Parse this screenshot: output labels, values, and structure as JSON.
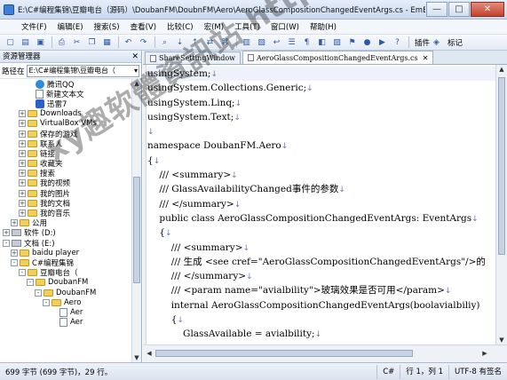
{
  "window": {
    "title": "E:\\C#编程集锦\\豆瓣电台（源码）\\DoubanFM\\DoubnFM\\Aero\\AeroGlassCompositionChangedEventArgs.cs - EmEditor",
    "minimize": "—",
    "maximize": "□",
    "close": "✕"
  },
  "menu": [
    "文件(F)",
    "编辑(E)",
    "搜索(S)",
    "查看(V)",
    "比较(C)",
    "宏(M)",
    "工具(T)",
    "窗口(W)",
    "帮助(H)"
  ],
  "toolbar": {
    "plugin_label": "插件",
    "mark_label": "标记"
  },
  "left_panel": {
    "title": "资源管理器",
    "close": "✕",
    "path_label": "路径在",
    "path_value": "E:\\C#编程集锦\\豆瓣电台（",
    "tree": [
      {
        "label": "腾讯QQ",
        "icon": "qq-icon",
        "indent": 4,
        "toggle": ""
      },
      {
        "label": "新建文本文",
        "icon": "file-icon",
        "indent": 4,
        "toggle": ""
      },
      {
        "label": "迅雷7",
        "icon": "thunder-icon",
        "indent": 4,
        "toggle": ""
      },
      {
        "label": "Downloads",
        "icon": "folder-icon",
        "indent": 3,
        "toggle": "+"
      },
      {
        "label": "VirtualBox VMs",
        "icon": "folder-icon",
        "indent": 3,
        "toggle": "+"
      },
      {
        "label": "保存的游戏",
        "icon": "folder-icon",
        "indent": 3,
        "toggle": "+"
      },
      {
        "label": "联系人",
        "icon": "folder-icon",
        "indent": 3,
        "toggle": "+"
      },
      {
        "label": "链接",
        "icon": "folder-icon",
        "indent": 3,
        "toggle": "+"
      },
      {
        "label": "收藏夹",
        "icon": "folder-icon",
        "indent": 3,
        "toggle": "+"
      },
      {
        "label": "搜索",
        "icon": "folder-icon",
        "indent": 3,
        "toggle": "+"
      },
      {
        "label": "我的视频",
        "icon": "folder-icon",
        "indent": 3,
        "toggle": "+"
      },
      {
        "label": "我的图片",
        "icon": "folder-icon",
        "indent": 3,
        "toggle": "+"
      },
      {
        "label": "我的文档",
        "icon": "folder-icon",
        "indent": 3,
        "toggle": "+"
      },
      {
        "label": "我的音乐",
        "icon": "folder-icon",
        "indent": 3,
        "toggle": "+"
      },
      {
        "label": "公用",
        "icon": "folder-icon",
        "indent": 2,
        "toggle": "+"
      },
      {
        "label": "软件 (D:)",
        "icon": "drive-icon",
        "indent": 1,
        "toggle": "+"
      },
      {
        "label": "文档 (E:)",
        "icon": "drive-icon",
        "indent": 1,
        "toggle": "-"
      },
      {
        "label": "baidu player",
        "icon": "folder-icon",
        "indent": 2,
        "toggle": "+"
      },
      {
        "label": "C#编程集锦",
        "icon": "folder-icon",
        "indent": 2,
        "toggle": "-"
      },
      {
        "label": "豆瓣电台（",
        "icon": "folder-icon",
        "indent": 3,
        "toggle": "-"
      },
      {
        "label": "DoubanFM",
        "icon": "folder-icon",
        "indent": 4,
        "toggle": "-"
      },
      {
        "label": "DoubanFM",
        "icon": "folder-icon",
        "indent": 5,
        "toggle": "-"
      },
      {
        "label": "Aero",
        "icon": "folder-icon",
        "indent": 6,
        "toggle": "-"
      },
      {
        "label": "Aer",
        "icon": "file-icon",
        "indent": 7,
        "toggle": ""
      },
      {
        "label": "Aer",
        "icon": "file-icon",
        "indent": 7,
        "toggle": ""
      }
    ]
  },
  "tabs": [
    {
      "label": "ShareSettingWindow",
      "active": false
    },
    {
      "label": "AeroGlassCompositionChangedEventArgs.cs",
      "active": true
    }
  ],
  "code_lines": [
    {
      "text": "usingSystem;",
      "mark": "↓"
    },
    {
      "text": "usingSystem.Collections.Generic;",
      "mark": "↓"
    },
    {
      "text": "usingSystem.Linq;",
      "mark": "↓"
    },
    {
      "text": "usingSystem.Text;",
      "mark": "↓"
    },
    {
      "text": "",
      "mark": "↓"
    },
    {
      "text": "namespace DoubanFM.Aero",
      "mark": "↓"
    },
    {
      "text": "{",
      "mark": "↓"
    },
    {
      "text": "    /// <summary>",
      "mark": "↓"
    },
    {
      "text": "    /// GlassAvailabilityChanged事件的参数",
      "mark": "↓"
    },
    {
      "text": "    /// </summary>",
      "mark": "↓"
    },
    {
      "text": "    public class AeroGlassCompositionChangedEventArgs: EventArgs",
      "mark": "↓"
    },
    {
      "text": "    {",
      "mark": "↓"
    },
    {
      "text": "        /// <summary>",
      "mark": "↓"
    },
    {
      "text": "        /// 生成 <see cref=\"AeroGlassCompositionChangedEventArgs\"/>的",
      "mark": ""
    },
    {
      "text": "        /// </summary>",
      "mark": "↓"
    },
    {
      "text": "        /// <param name=\"avialbility\">玻璃效果是否可用</param>",
      "mark": "↓"
    },
    {
      "text": "        internal AeroGlassCompositionChangedEventArgs(boolavialbiliy)",
      "mark": ""
    },
    {
      "text": "        {",
      "mark": "↓"
    },
    {
      "text": "            GlassAvailable = avialbility;",
      "mark": "↓"
    },
    {
      "text": "        }",
      "mark": "↓"
    }
  ],
  "status": {
    "left": "699 字节 (699 字节)，29 行。",
    "language": "C#",
    "position": "行 1，列 1",
    "encoding": "UTF-8 有签名"
  },
  "watermark": "xy趣软體資訊站 http://31.to"
}
